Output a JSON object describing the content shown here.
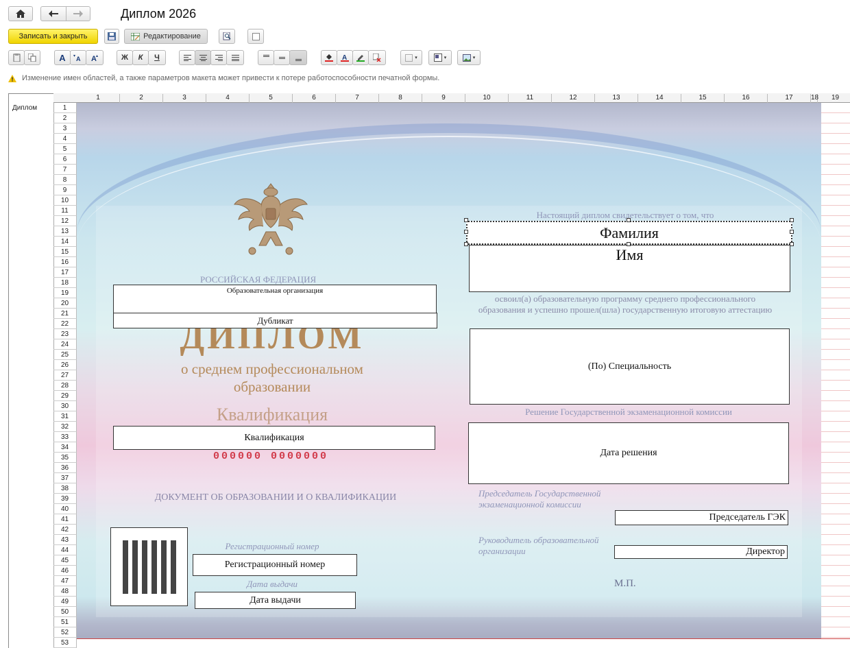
{
  "window": {
    "title": "Диплом 2026"
  },
  "toolbar": {
    "save_close": "Записать и закрыть",
    "editing": "Редактирование",
    "bold": "Ж",
    "italic": "К",
    "underline": "Ч",
    "font_a": "A"
  },
  "warning": "Изменение имен областей, а также параметров макета может привести к потере работоспособности печатной формы.",
  "grid": {
    "area_name": "Диплом",
    "columns": [
      "1",
      "2",
      "3",
      "4",
      "5",
      "6",
      "7",
      "8",
      "9",
      "10",
      "11",
      "12",
      "13",
      "14",
      "15",
      "16",
      "17",
      "18",
      "19"
    ],
    "rows": [
      "1",
      "2",
      "3",
      "4",
      "5",
      "6",
      "7",
      "8",
      "9",
      "10",
      "11",
      "12",
      "13",
      "14",
      "15",
      "16",
      "17",
      "18",
      "19",
      "20",
      "21",
      "22",
      "23",
      "24",
      "25",
      "26",
      "27",
      "28",
      "29",
      "30",
      "31",
      "32",
      "33",
      "34",
      "35",
      "36",
      "37",
      "38",
      "39",
      "40",
      "41",
      "42",
      "43",
      "44",
      "45",
      "46",
      "47",
      "48",
      "49",
      "50",
      "51",
      "52",
      "53"
    ]
  },
  "diploma": {
    "russia": "РОССИЙСКАЯ ФЕДЕРАЦИЯ",
    "org_field": "Образовательная организация",
    "duplicate_field": "Дубликат",
    "big_title": "ДИПЛОМ",
    "subtitle1": "о среднем профессиональном",
    "subtitle2": "образовании",
    "qualification_heading": "Квалификация",
    "qualification_field": "Квалификация",
    "serial": "000000 0000000",
    "doc_caption": "ДОКУМЕНТ ОБ ОБРАЗОВАНИИ И О КВАЛИФИКАЦИИ",
    "reg_caption": "Регистрационный номер",
    "reg_field": "Регистрационный номер",
    "issue_caption": "Дата выдачи",
    "issue_field": "Дата выдачи",
    "certify_caption": "Настоящий диплом свидетельствует о том, что",
    "surname_field": "Фамилия",
    "name_field": "Имя",
    "mastered_text": "освоил(а) образовательную программу среднего профессионального образования и успешно прошел(шла) государственную итоговую аттестацию",
    "specialty_field": "(По) Специальность",
    "decision_caption": "Решение Государственной экзаменационной комиссии",
    "decision_field": "Дата решения",
    "chair_caption": "Председатель Государственной экзаменационной комиссии",
    "chair_field": "Председатель ГЭК",
    "head_caption": "Руководитель образовательной организации",
    "director_field": "Директор",
    "stamp": "М.П."
  }
}
